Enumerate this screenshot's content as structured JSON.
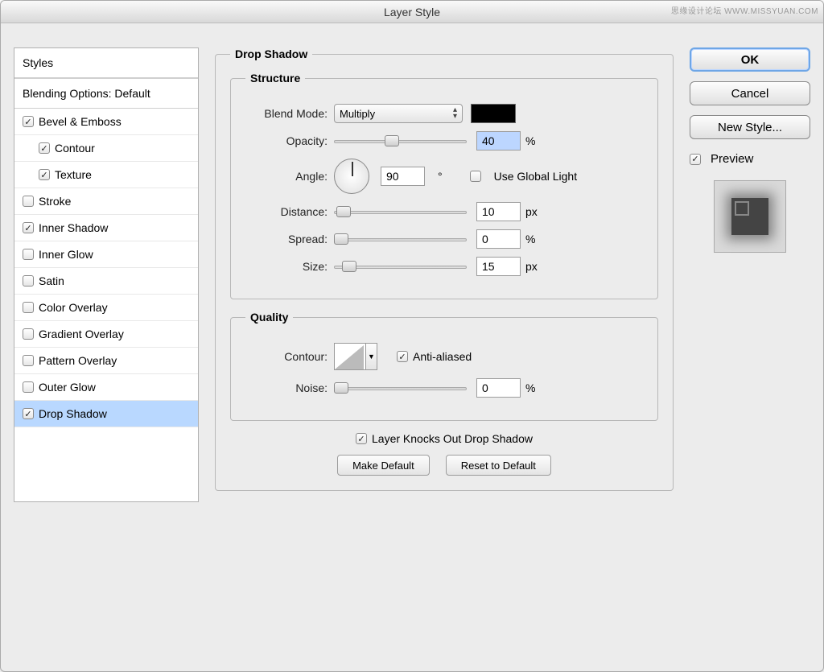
{
  "window": {
    "title": "Layer Style",
    "watermark": "思缘设计论坛  WWW.MISSYUAN.COM"
  },
  "sidebar": {
    "header": "Styles",
    "blending": "Blending Options: Default",
    "items": [
      {
        "label": "Bevel & Emboss",
        "checked": true,
        "indent": false
      },
      {
        "label": "Contour",
        "checked": true,
        "indent": true
      },
      {
        "label": "Texture",
        "checked": true,
        "indent": true
      },
      {
        "label": "Stroke",
        "checked": false,
        "indent": false
      },
      {
        "label": "Inner Shadow",
        "checked": true,
        "indent": false
      },
      {
        "label": "Inner Glow",
        "checked": false,
        "indent": false
      },
      {
        "label": "Satin",
        "checked": false,
        "indent": false
      },
      {
        "label": "Color Overlay",
        "checked": false,
        "indent": false
      },
      {
        "label": "Gradient Overlay",
        "checked": false,
        "indent": false
      },
      {
        "label": "Pattern Overlay",
        "checked": false,
        "indent": false
      },
      {
        "label": "Outer Glow",
        "checked": false,
        "indent": false
      },
      {
        "label": "Drop Shadow",
        "checked": true,
        "indent": false,
        "selected": true
      }
    ]
  },
  "panel": {
    "title": "Drop Shadow",
    "structure": {
      "legend": "Structure",
      "blend_mode_label": "Blend Mode:",
      "blend_mode_value": "Multiply",
      "color": "#000000",
      "opacity_label": "Opacity:",
      "opacity_value": "40",
      "opacity_unit": "%",
      "angle_label": "Angle:",
      "angle_value": "90",
      "angle_unit": "°",
      "global_light_label": "Use Global Light",
      "global_light_checked": false,
      "distance_label": "Distance:",
      "distance_value": "10",
      "distance_unit": "px",
      "spread_label": "Spread:",
      "spread_value": "0",
      "spread_unit": "%",
      "size_label": "Size:",
      "size_value": "15",
      "size_unit": "px"
    },
    "quality": {
      "legend": "Quality",
      "contour_label": "Contour:",
      "antialias_label": "Anti-aliased",
      "antialias_checked": true,
      "noise_label": "Noise:",
      "noise_value": "0",
      "noise_unit": "%"
    },
    "knockout_label": "Layer Knocks Out Drop Shadow",
    "knockout_checked": true,
    "make_default": "Make Default",
    "reset_default": "Reset to Default"
  },
  "right": {
    "ok": "OK",
    "cancel": "Cancel",
    "new_style": "New Style...",
    "preview_label": "Preview",
    "preview_checked": true
  }
}
